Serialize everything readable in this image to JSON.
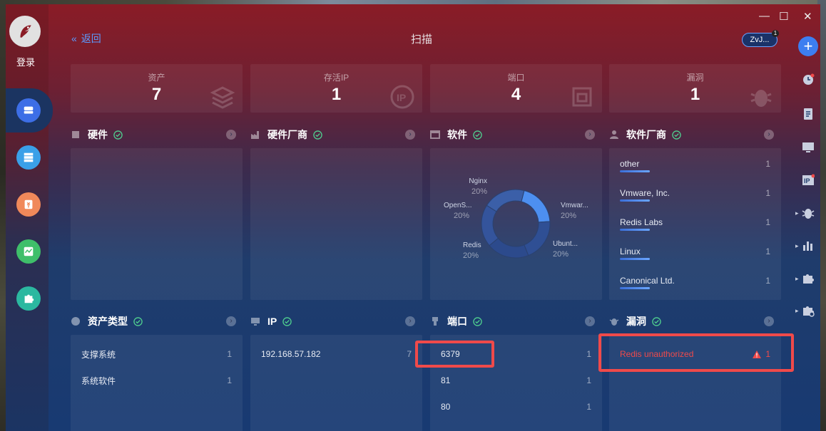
{
  "app": {
    "title": "扫描",
    "back_label": "返回",
    "login_label": "登录",
    "user_label": "ZvJ...",
    "user_notifications": "1"
  },
  "window_controls": {
    "minimize": "—",
    "maximize": "☐",
    "close": "✕"
  },
  "stats": [
    {
      "label": "资产",
      "value": "7",
      "icon": "layers-icon"
    },
    {
      "label": "存活IP",
      "value": "1",
      "icon": "ip-icon"
    },
    {
      "label": "端口",
      "value": "4",
      "icon": "port-icon"
    },
    {
      "label": "漏洞",
      "value": "1",
      "icon": "bug-icon"
    }
  ],
  "sections": {
    "hardware": {
      "title": "硬件"
    },
    "hardware_vendor": {
      "title": "硬件厂商"
    },
    "software": {
      "title": "软件"
    },
    "software_vendor": {
      "title": "软件厂商"
    },
    "asset_type": {
      "title": "资产类型"
    },
    "ip": {
      "title": "IP"
    },
    "port": {
      "title": "端口"
    },
    "vuln": {
      "title": "漏洞"
    }
  },
  "software_chart": {
    "type": "pie",
    "categories": [
      "Nginx",
      "Vmwar...",
      "Ubunt...",
      "Redis",
      "OpenS..."
    ],
    "values": [
      20,
      20,
      20,
      20,
      20
    ],
    "percent_labels": [
      "20%",
      "20%",
      "20%",
      "20%",
      "20%"
    ],
    "colors": [
      "#4d8ff0",
      "#2f4f94",
      "#2c4a8c",
      "#34549c",
      "#3b5fa8"
    ]
  },
  "software_vendors": [
    {
      "name": "other",
      "count": "1"
    },
    {
      "name": "Vmware, Inc.",
      "count": "1"
    },
    {
      "name": "Redis Labs",
      "count": "1"
    },
    {
      "name": "Linux",
      "count": "1"
    },
    {
      "name": "Canonical Ltd.",
      "count": "1"
    }
  ],
  "asset_types": [
    {
      "name": "支撑系统",
      "count": "1"
    },
    {
      "name": "系统软件",
      "count": "1"
    }
  ],
  "ips": [
    {
      "name": "192.168.57.182",
      "count": "7"
    }
  ],
  "ports": [
    {
      "name": "6379",
      "count": "1"
    },
    {
      "name": "81",
      "count": "1"
    },
    {
      "name": "80",
      "count": "1"
    }
  ],
  "vulns": [
    {
      "name": "Redis unauthorized",
      "count": "1",
      "icon": "warning-icon"
    }
  ],
  "colors": {
    "accent": "#5b9bff",
    "danger": "#f04a4a",
    "check": "#4fcf8f"
  }
}
